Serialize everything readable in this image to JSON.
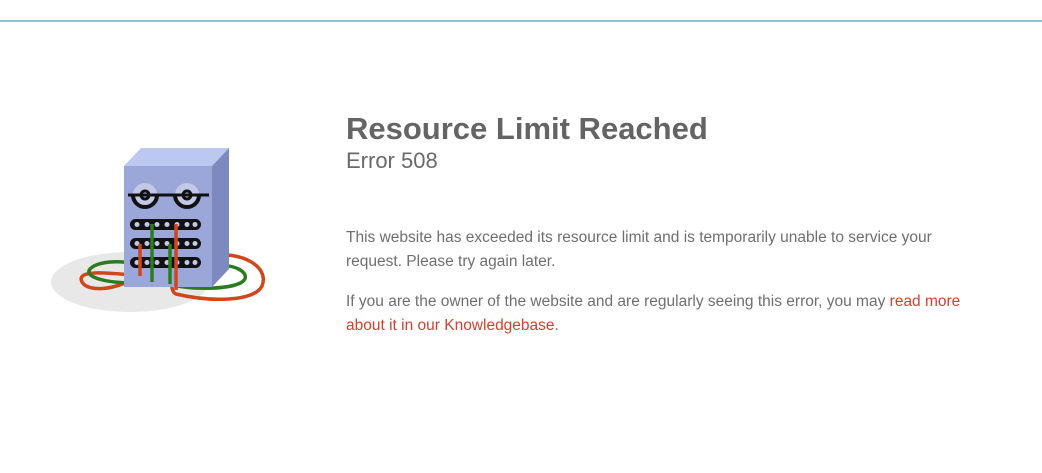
{
  "colors": {
    "top_rule": "#8fc3cf",
    "title": "#646464",
    "body_text": "#6f6f6f",
    "link": "#d2412f",
    "server_front": "#9aa7d8",
    "server_top": "#bcc8ef",
    "server_side": "#7d8ac0",
    "cable_green": "#2a7d1f",
    "cable_orange": "#d1461c",
    "shadow": "#e8e8e8"
  },
  "illustration": {
    "icon": "sleeping-server-illustration"
  },
  "error": {
    "title": "Resource Limit Reached",
    "code": "Error 508"
  },
  "message": {
    "line1": "This website has exceeded its resource limit and is temporarily unable to service your request. Please try again later.",
    "owner_text": "If you are the owner of the website and are regularly seeing this error, you may ",
    "link_text": "read more about it in our Knowledgebase",
    "owner_suffix": "."
  }
}
